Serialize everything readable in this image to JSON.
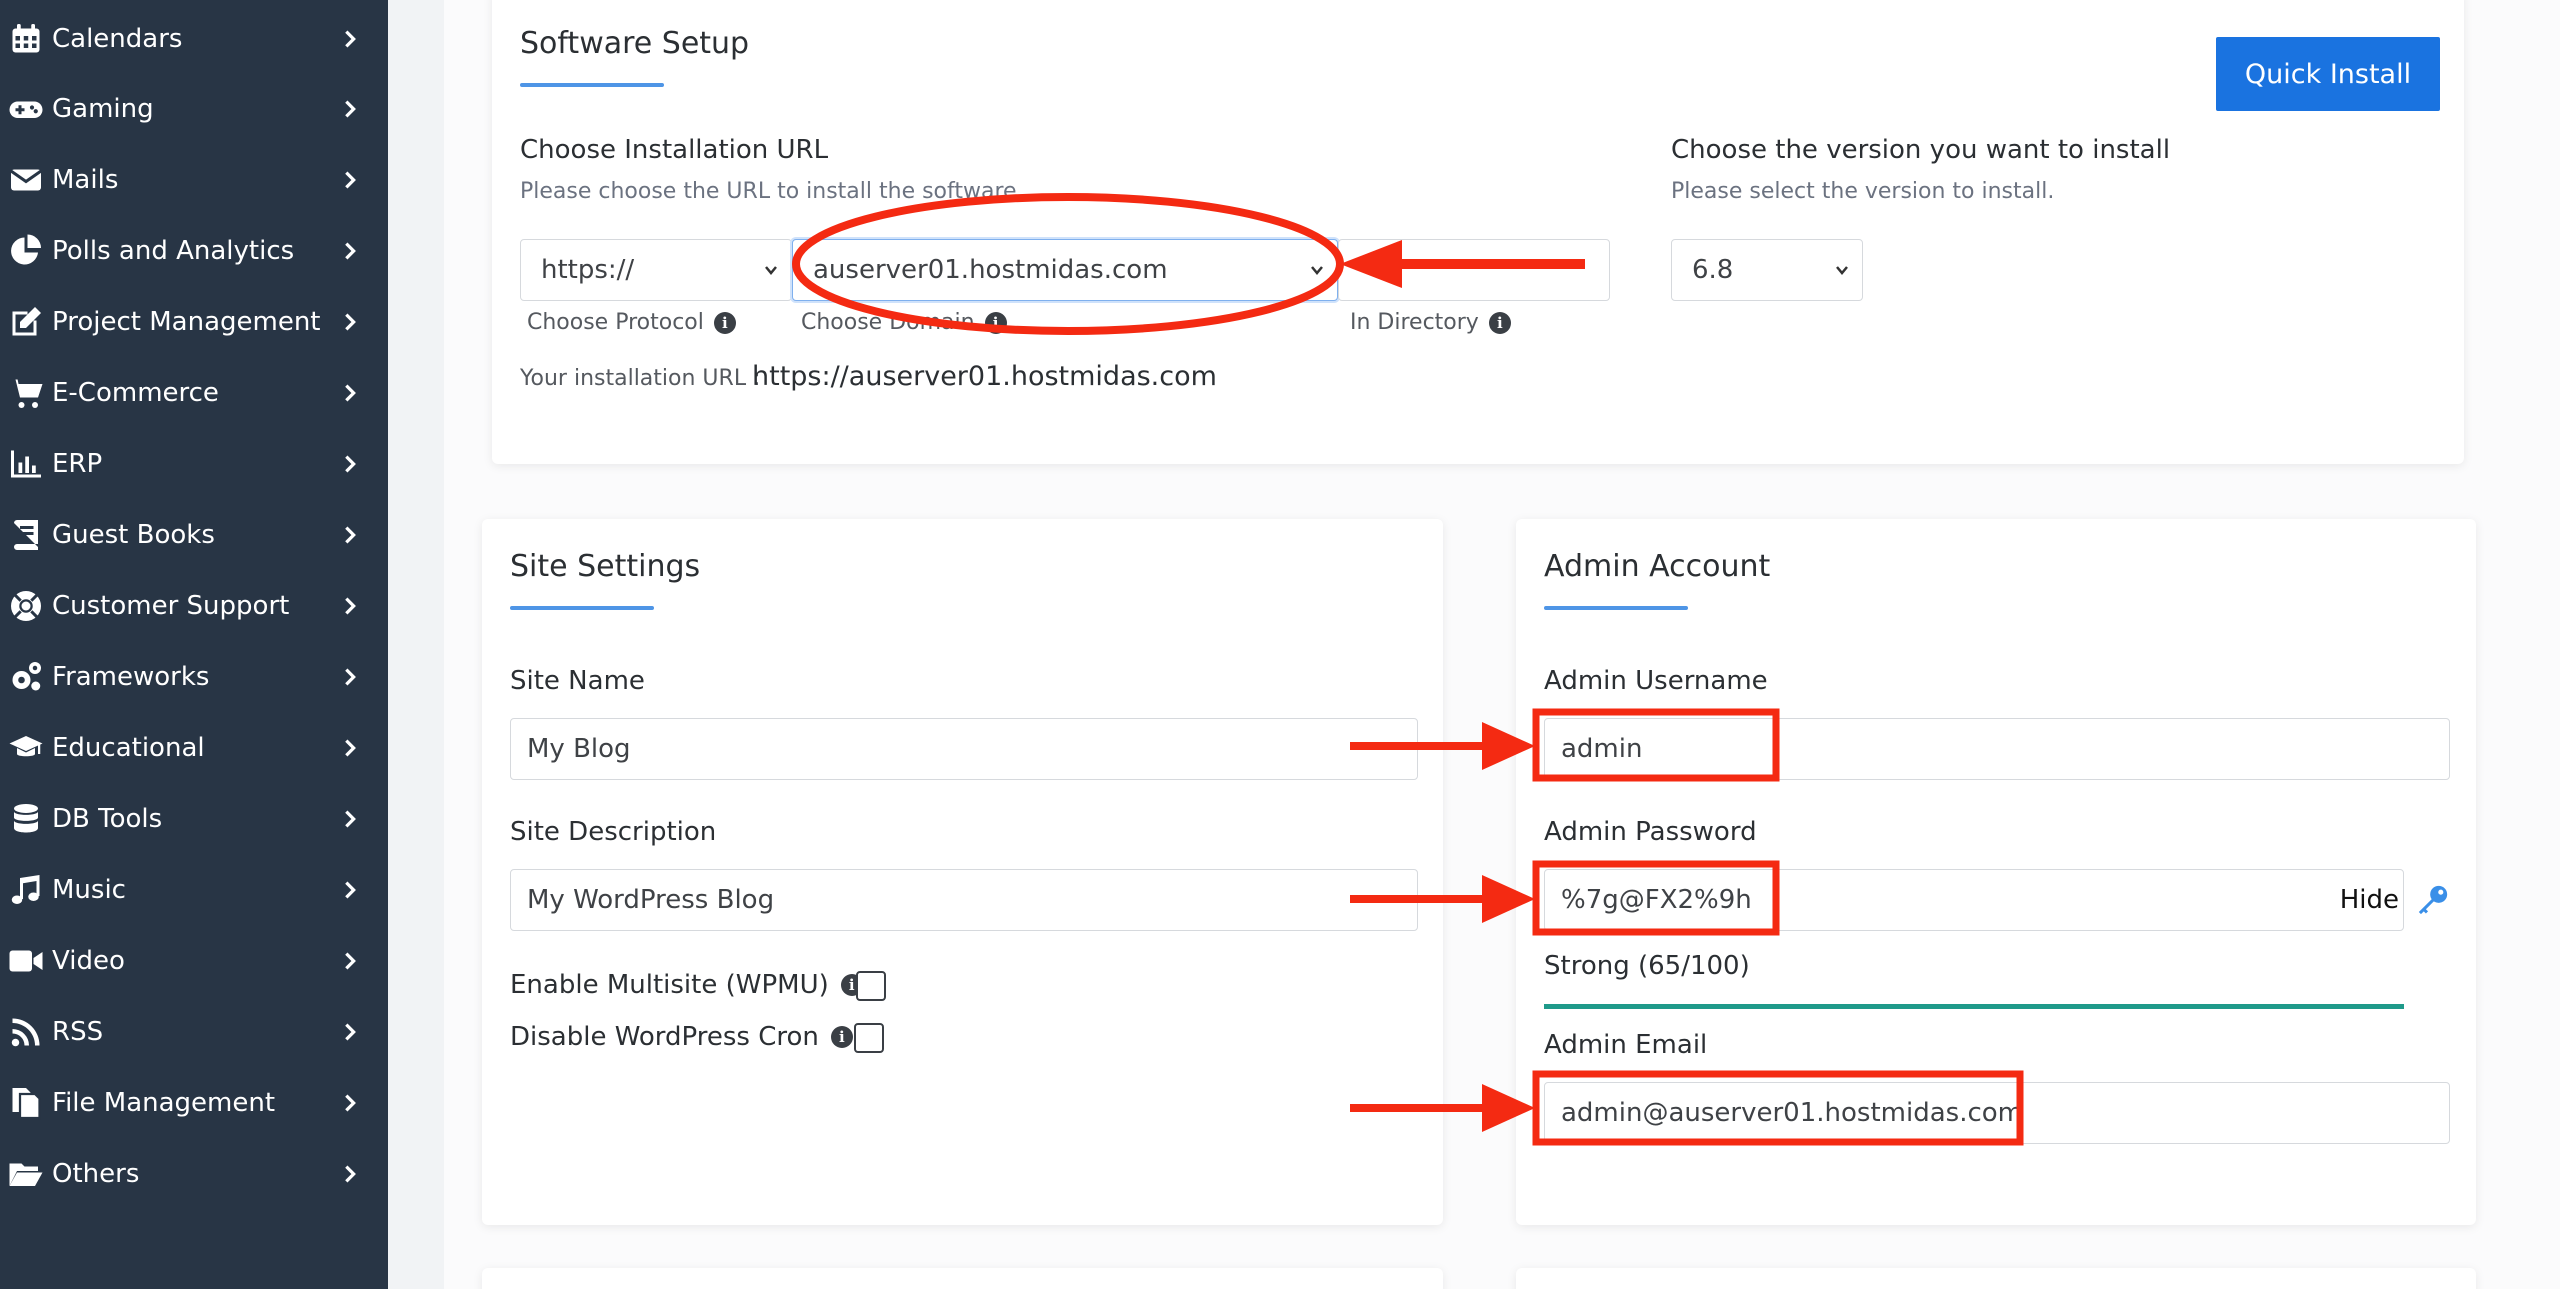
{
  "sidebar": {
    "items": [
      {
        "label": "Calendars",
        "icon": "calendar-icon"
      },
      {
        "label": "Gaming",
        "icon": "gamepad-icon"
      },
      {
        "label": "Mails",
        "icon": "envelope-icon"
      },
      {
        "label": "Polls and Analytics",
        "icon": "pie-chart-icon"
      },
      {
        "label": "Project Management",
        "icon": "edit-icon"
      },
      {
        "label": "E-Commerce",
        "icon": "cart-icon"
      },
      {
        "label": "ERP",
        "icon": "bar-chart-icon"
      },
      {
        "label": "Guest Books",
        "icon": "book-icon"
      },
      {
        "label": "Customer Support",
        "icon": "lifebuoy-icon"
      },
      {
        "label": "Frameworks",
        "icon": "cogs-icon"
      },
      {
        "label": "Educational",
        "icon": "graduation-cap-icon"
      },
      {
        "label": "DB Tools",
        "icon": "database-icon"
      },
      {
        "label": "Music",
        "icon": "music-icon"
      },
      {
        "label": "Video",
        "icon": "video-icon"
      },
      {
        "label": "RSS",
        "icon": "rss-icon"
      },
      {
        "label": "File Management",
        "icon": "files-icon"
      },
      {
        "label": "Others",
        "icon": "folder-open-icon"
      }
    ]
  },
  "software_setup": {
    "title": "Software Setup",
    "quick_install_label": "Quick Install",
    "install_url_label": "Choose Installation URL",
    "install_url_hint": "Please choose the URL to install the software",
    "protocol_value": "https://",
    "domain_value": "auserver01.hostmidas.com",
    "directory_value": "",
    "protocol_caption": "Choose Protocol",
    "domain_caption": "Choose Domain",
    "directory_caption": "In Directory",
    "install_url_prefix": "Your installation URL :",
    "install_url_value": "https://auserver01.hostmidas.com",
    "version_label": "Choose the version you want to install",
    "version_hint": "Please select the version to install.",
    "version_value": "6.8"
  },
  "site_settings": {
    "title": "Site Settings",
    "site_name_label": "Site Name",
    "site_name_value": "My Blog",
    "site_desc_label": "Site Description",
    "site_desc_value": "My WordPress Blog",
    "multisite_label": "Enable Multisite (WPMU)",
    "cron_label": "Disable WordPress Cron"
  },
  "admin_account": {
    "title": "Admin Account",
    "username_label": "Admin Username",
    "username_value": "admin",
    "password_label": "Admin Password",
    "password_value": "%7g@FX2%9h",
    "hide_label": "Hide",
    "strength_label": "Strength",
    "strength_text": "Strong (65/100)",
    "strength_score": 65,
    "email_label": "Admin Email",
    "email_value": "admin@auserver01.hostmidas.com"
  },
  "colors": {
    "sidebar_bg": "#283545",
    "accent": "#1a73e0",
    "underline": "#4e95e6",
    "annotation_red": "#f42a12",
    "strength_bar": "#1f9a8a"
  }
}
